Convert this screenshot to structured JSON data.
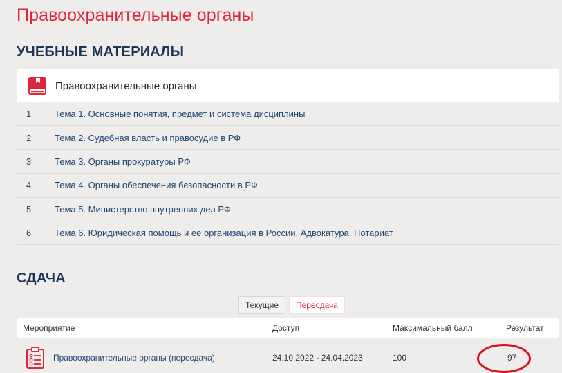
{
  "page_title": "Правоохранительные органы",
  "materials": {
    "heading": "УЧЕБНЫЕ МАТЕРИАЛЫ",
    "course": {
      "name": "Правоохранительные органы",
      "icon": "book-icon"
    },
    "topics": [
      {
        "num": "1",
        "title": "Тема 1. Основные понятия, предмет и система дисциплины"
      },
      {
        "num": "2",
        "title": "Тема 2. Судебная власть и правосудие в РФ"
      },
      {
        "num": "3",
        "title": "Тема 3. Органы прокуратуры РФ"
      },
      {
        "num": "4",
        "title": "Тема 4. Органы обеспечения безопасности в РФ"
      },
      {
        "num": "5",
        "title": "Тема 5. Министерство внутренних дел РФ"
      },
      {
        "num": "6",
        "title": "Тема 6. Юридическая помощь и ее организация в России. Адвокатура. Нотариат"
      }
    ]
  },
  "exams": {
    "heading": "СДАЧА",
    "tabs": [
      {
        "label": "Текущие",
        "active": false
      },
      {
        "label": "Пересдача",
        "active": true
      }
    ],
    "columns": [
      "Мероприятие",
      "Доступ",
      "Максимальный балл",
      "Результат"
    ],
    "rows": [
      {
        "event": "Правоохранительные органы (пересдача)",
        "access": "24.10.2022 - 24.04.2023",
        "max_score": "100",
        "result": "97",
        "icon": "test-clipboard-icon"
      }
    ]
  },
  "colors": {
    "accent": "#e0243a",
    "heading": "#1e3557",
    "link": "#1f4673",
    "background": "#efedec",
    "highlight_circle": "#d6141e"
  }
}
